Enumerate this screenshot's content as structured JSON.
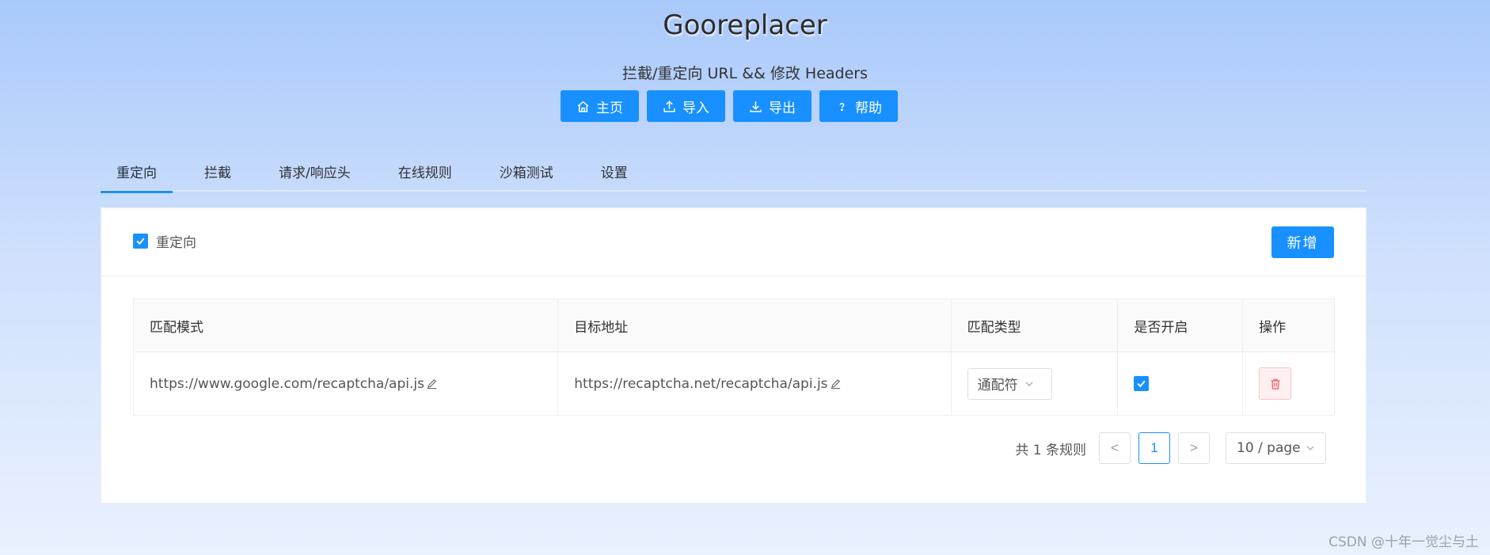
{
  "app": {
    "title": "Gooreplacer",
    "subtitle": "拦截/重定向 URL && 修改 Headers"
  },
  "toolbar": {
    "home": "主页",
    "import": "导入",
    "export": "导出",
    "help": "帮助"
  },
  "tabs": [
    {
      "label": "重定向",
      "active": true
    },
    {
      "label": "拦截"
    },
    {
      "label": "请求/响应头"
    },
    {
      "label": "在线规则"
    },
    {
      "label": "沙箱测试"
    },
    {
      "label": "设置"
    }
  ],
  "panel": {
    "enable_label": "重定向",
    "enable_checked": true,
    "add_label": "新增"
  },
  "table": {
    "columns": [
      "匹配模式",
      "目标地址",
      "匹配类型",
      "是否开启",
      "操作"
    ],
    "rows": [
      {
        "pattern": "https://www.google.com/recaptcha/api.js",
        "target": "https://recaptcha.net/recaptcha/api.js",
        "match_type": "通配符",
        "enabled": true
      }
    ]
  },
  "pagination": {
    "total_text": "共 1 条规则",
    "current_page": "1",
    "prev": "<",
    "next": ">",
    "page_size": "10 / page"
  },
  "watermark": "CSDN @十年一觉尘与土",
  "colors": {
    "primary": "#1890ff",
    "danger": "#f56c6c"
  }
}
